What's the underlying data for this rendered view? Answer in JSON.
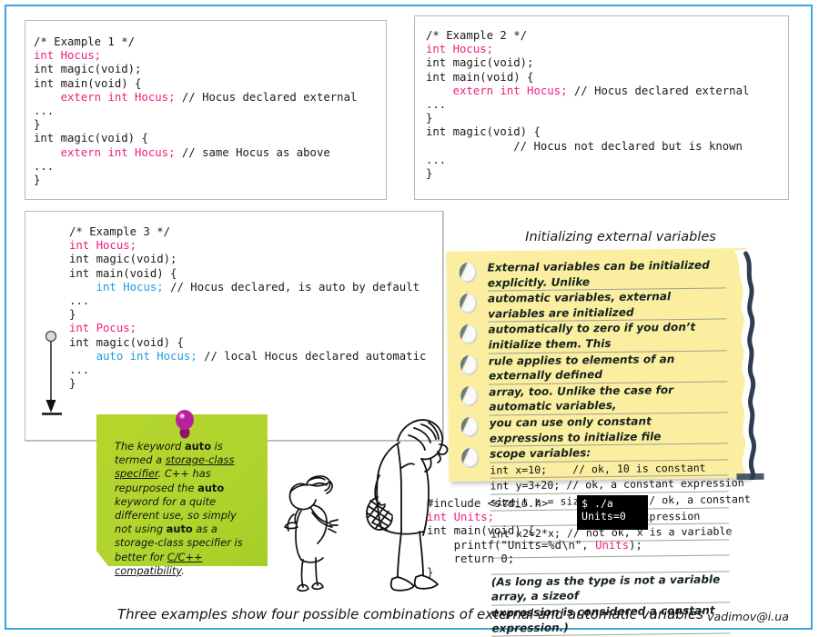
{
  "frame": {
    "border_color": "#3aa6d8"
  },
  "colors": {
    "keyword_pink": "#ef1e7e",
    "keyword_blue": "#1b9ede",
    "note_yellow": "#fbeea0",
    "sticky_green": "#b4d52c",
    "terminal_bg": "#000000"
  },
  "examples": {
    "ex1": {
      "title": "/* Example 1 */",
      "lines": [
        [
          {
            "t": "/* Example 1 */",
            "c": "plain"
          }
        ],
        [
          {
            "t": "int Hocus;",
            "c": "pink"
          }
        ],
        [
          {
            "t": "int magic(void);",
            "c": "plain"
          }
        ],
        [
          {
            "t": "int main(void) {",
            "c": "plain"
          }
        ],
        [
          {
            "t": "    ",
            "c": "plain"
          },
          {
            "t": "extern int Hocus;",
            "c": "pink"
          },
          {
            "t": " // Hocus declared external",
            "c": "plain"
          }
        ],
        [
          {
            "t": "...",
            "c": "plain"
          }
        ],
        [
          {
            "t": "}",
            "c": "plain"
          }
        ],
        [
          {
            "t": "int magic(void) {",
            "c": "plain"
          }
        ],
        [
          {
            "t": "    ",
            "c": "plain"
          },
          {
            "t": "extern int Hocus;",
            "c": "pink"
          },
          {
            "t": " // same Hocus as above",
            "c": "plain"
          }
        ],
        [
          {
            "t": "...",
            "c": "plain"
          }
        ],
        [
          {
            "t": "}",
            "c": "plain"
          }
        ]
      ]
    },
    "ex2": {
      "title": "/* Example 2 */",
      "lines": [
        [
          {
            "t": "/* Example 2 */",
            "c": "plain"
          }
        ],
        [
          {
            "t": "int Hocus;",
            "c": "pink"
          }
        ],
        [
          {
            "t": "int magic(void);",
            "c": "plain"
          }
        ],
        [
          {
            "t": "int main(void) {",
            "c": "plain"
          }
        ],
        [
          {
            "t": "    ",
            "c": "plain"
          },
          {
            "t": "extern int Hocus;",
            "c": "pink"
          },
          {
            "t": " // Hocus declared external",
            "c": "plain"
          }
        ],
        [
          {
            "t": "...",
            "c": "plain"
          }
        ],
        [
          {
            "t": "}",
            "c": "plain"
          }
        ],
        [
          {
            "t": "int magic(void) {",
            "c": "plain"
          }
        ],
        [
          {
            "t": "             // Hocus not declared but is known",
            "c": "plain"
          }
        ],
        [
          {
            "t": "...",
            "c": "plain"
          }
        ],
        [
          {
            "t": "}",
            "c": "plain"
          }
        ]
      ]
    },
    "ex3": {
      "title": "/* Example 3 */",
      "lines": [
        [
          {
            "t": "/* Example 3 */",
            "c": "plain"
          }
        ],
        [
          {
            "t": "int Hocus;",
            "c": "pink"
          }
        ],
        [
          {
            "t": "int magic(void);",
            "c": "plain"
          }
        ],
        [
          {
            "t": "int main(void) {",
            "c": "plain"
          }
        ],
        [
          {
            "t": "    ",
            "c": "plain"
          },
          {
            "t": "int Hocus;",
            "c": "blue"
          },
          {
            "t": " // Hocus declared, is auto by default",
            "c": "plain"
          }
        ],
        [
          {
            "t": "...",
            "c": "plain"
          }
        ],
        [
          {
            "t": "}",
            "c": "plain"
          }
        ],
        [
          {
            "t": "",
            "c": "plain"
          }
        ],
        [
          {
            "t": "int Pocus;",
            "c": "pink"
          }
        ],
        [
          {
            "t": "",
            "c": "plain"
          }
        ],
        [
          {
            "t": "int magic(void) {",
            "c": "plain"
          }
        ],
        [
          {
            "t": "    ",
            "c": "plain"
          },
          {
            "t": "auto int Hocus;",
            "c": "blue"
          },
          {
            "t": " // local Hocus declared automatic",
            "c": "plain"
          }
        ],
        [
          {
            "t": "...",
            "c": "plain"
          }
        ],
        [
          {
            "t": "}",
            "c": "plain"
          }
        ]
      ]
    }
  },
  "yellow_note": {
    "title": "Initializing external variables",
    "hole_count": 7,
    "body": [
      {
        "kind": "italic",
        "text": "External variables can be initialized explicitly. Unlike"
      },
      {
        "kind": "italic",
        "text": "automatic variables, external variables are initialized"
      },
      {
        "kind": "italic",
        "text": "automatically to zero if you don’t initialize them. This"
      },
      {
        "kind": "italic",
        "text": "rule applies to elements of an externally defined"
      },
      {
        "kind": "italic",
        "text": "array, too. Unlike the case for automatic variables,"
      },
      {
        "kind": "italic",
        "text": "you can use only constant expressions to initialize file"
      },
      {
        "kind": "italic",
        "text": "scope variables:"
      },
      {
        "kind": "code",
        "text": "int x=10;    // ok, 10 is constant"
      },
      {
        "kind": "code",
        "text": "int y=3+20; // ok, a constant expression"
      },
      {
        "kind": "code",
        "text": "size_t z = sizeof(int); // ok, a constant"
      },
      {
        "kind": "code",
        "text": "                    // expression"
      },
      {
        "kind": "code",
        "text": "int x2=2*x; // not ok, x is a variable"
      },
      {
        "kind": "blank",
        "text": ""
      },
      {
        "kind": "blank",
        "text": ""
      },
      {
        "kind": "italic",
        "text": "(As long as the type is not a variable array, a sizeof"
      },
      {
        "kind": "italic",
        "text": "expression is considered a constant expression.)"
      }
    ]
  },
  "green_note": {
    "segments": [
      {
        "t": "The keyword ",
        "s": "italic"
      },
      {
        "t": "auto",
        "s": "bold"
      },
      {
        "t": " is termed a ",
        "s": "italic"
      },
      {
        "t": "storage-class specifier",
        "s": "italic-underline"
      },
      {
        "t": ". C++ has repurposed the ",
        "s": "italic"
      },
      {
        "t": "auto",
        "s": "bold"
      },
      {
        "t": " keyword for a quite different use, so simply not using ",
        "s": "italic"
      },
      {
        "t": "auto",
        "s": "bold"
      },
      {
        "t": " as a storage-class specifier is better for ",
        "s": "italic"
      },
      {
        "t": "C/C++ compatibility",
        "s": "italic-underline"
      },
      {
        "t": ".",
        "s": "italic"
      }
    ],
    "plain_text": "The keyword auto is termed a storage-class specifier. C++ has repurposed the auto keyword for a quite different use, so simply not using auto as a storage-class specifier is better for C/C++ compatibility."
  },
  "bottom_program": {
    "lines": [
      [
        {
          "t": "#include <stdio.h>",
          "c": "plain"
        }
      ],
      [
        {
          "t": "int Units;",
          "c": "pink"
        }
      ],
      [
        {
          "t": "int main(void) {",
          "c": "plain"
        }
      ],
      [
        {
          "t": "    printf(\"Units=%d\\n\", ",
          "c": "plain"
        },
        {
          "t": "Units",
          "c": "pink"
        },
        {
          "t": ");",
          "c": "plain"
        }
      ],
      [
        {
          "t": "    return 0;",
          "c": "plain"
        }
      ],
      [
        {
          "t": "}",
          "c": "plain"
        }
      ]
    ]
  },
  "terminal": {
    "prompt_line": "$ ./a",
    "output_line": "Units=0"
  },
  "caption": "Three examples show four possible combinations of external and automatic variables",
  "signature": "vadimov@i.ua"
}
